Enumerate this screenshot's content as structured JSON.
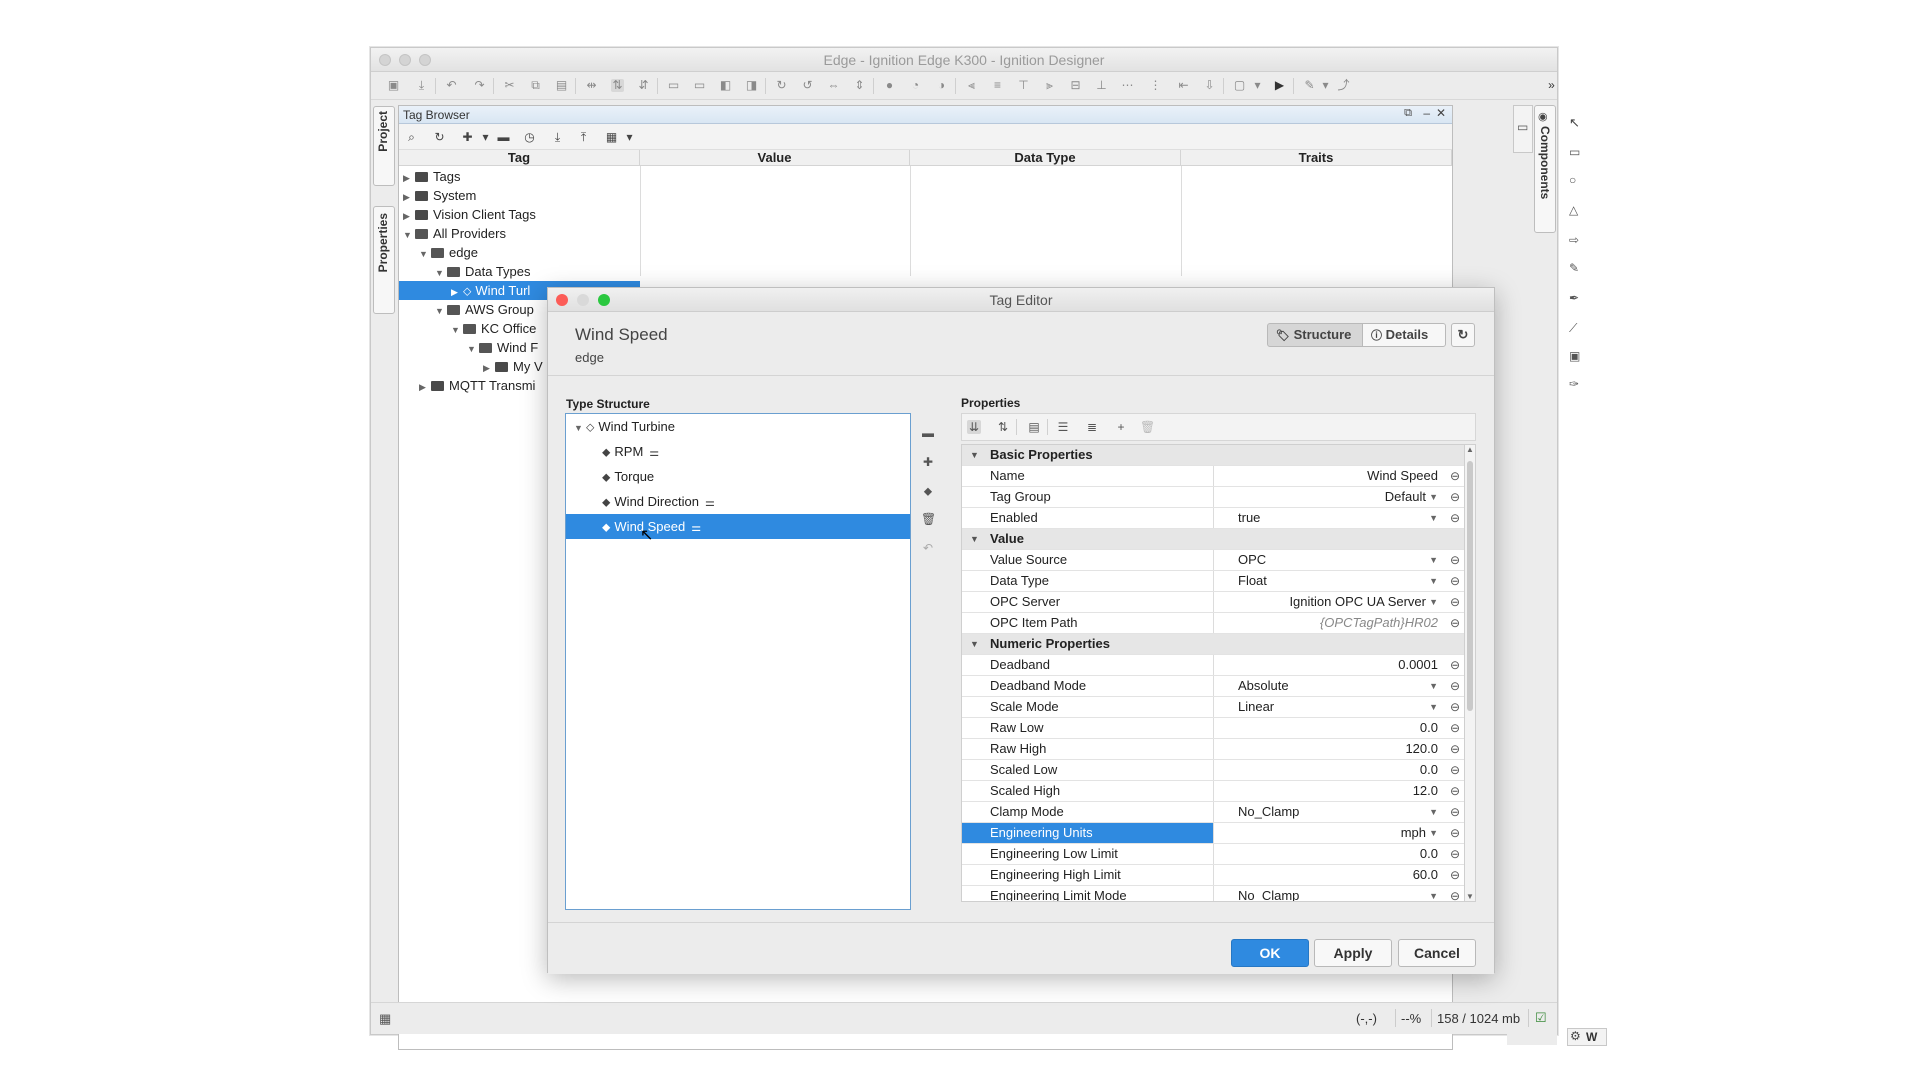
{
  "window": {
    "title": "Edge - Ignition Edge K300 - Ignition Designer"
  },
  "left_tabs": {
    "project": "Project",
    "properties": "Properties"
  },
  "right_tabs": {
    "components": "Components",
    "w_label": "W"
  },
  "tag_browser": {
    "title": "Tag Browser",
    "columns": [
      "Tag",
      "Value",
      "Data Type",
      "Traits"
    ],
    "tree": [
      {
        "label": "Tags",
        "depth": 0,
        "expanded": false,
        "kind": "folder"
      },
      {
        "label": "System",
        "depth": 0,
        "expanded": false,
        "kind": "folder"
      },
      {
        "label": "Vision Client Tags",
        "depth": 0,
        "expanded": false,
        "kind": "folder"
      },
      {
        "label": "All Providers",
        "depth": 0,
        "expanded": true,
        "kind": "folder"
      },
      {
        "label": "edge",
        "depth": 1,
        "expanded": true,
        "kind": "folder"
      },
      {
        "label": "Data Types",
        "depth": 2,
        "expanded": true,
        "kind": "folder"
      },
      {
        "label": "Wind Turl",
        "depth": 3,
        "expanded": false,
        "kind": "udt",
        "selected": true
      },
      {
        "label": "AWS Group",
        "depth": 2,
        "expanded": true,
        "kind": "folder"
      },
      {
        "label": "KC Office",
        "depth": 3,
        "expanded": true,
        "kind": "folder"
      },
      {
        "label": "Wind F",
        "depth": 4,
        "expanded": true,
        "kind": "folder"
      },
      {
        "label": "My V",
        "depth": 5,
        "expanded": false,
        "kind": "folder"
      },
      {
        "label": "MQTT Transmi",
        "depth": 1,
        "expanded": false,
        "kind": "folder"
      }
    ]
  },
  "status_bar": {
    "coords": "(-,-)",
    "zoom": "--%",
    "memory": "158 / 1024 mb"
  },
  "tag_editor": {
    "title": "Tag Editor",
    "tag_name": "Wind Speed",
    "provider": "edge",
    "structure_btn": "Structure",
    "details_btn": "Details",
    "type_structure_label": "Type Structure",
    "type_structure": [
      {
        "label": "Wind Turbine",
        "depth": 0,
        "expanded": true,
        "params": false,
        "selected": false
      },
      {
        "label": "RPM",
        "depth": 1,
        "params": true,
        "selected": false
      },
      {
        "label": "Torque",
        "depth": 1,
        "params": false,
        "selected": false
      },
      {
        "label": "Wind Direction",
        "depth": 1,
        "params": true,
        "selected": false
      },
      {
        "label": "Wind Speed",
        "depth": 1,
        "params": true,
        "selected": true
      }
    ],
    "properties_label": "Properties",
    "properties": [
      {
        "type": "cat",
        "name": "Basic Properties"
      },
      {
        "name": "Name",
        "value": "Wind Speed",
        "align": "right",
        "dropdown": false
      },
      {
        "name": "Tag Group",
        "value": "Default",
        "align": "right",
        "dropdown": true
      },
      {
        "name": "Enabled",
        "value": "true",
        "align": "left",
        "dropdown": true
      },
      {
        "type": "cat",
        "name": "Value"
      },
      {
        "name": "Value Source",
        "value": "OPC",
        "align": "left",
        "dropdown": true
      },
      {
        "name": "Data Type",
        "value": "Float",
        "align": "left",
        "dropdown": true
      },
      {
        "name": "OPC Server",
        "value": "Ignition OPC UA Server",
        "align": "right",
        "dropdown": true
      },
      {
        "name": "OPC Item Path",
        "value": "{OPCTagPath}HR02",
        "align": "right",
        "dropdown": false,
        "italic": true
      },
      {
        "type": "cat",
        "name": "Numeric Properties"
      },
      {
        "name": "Deadband",
        "value": "0.0001",
        "align": "right",
        "dropdown": false
      },
      {
        "name": "Deadband Mode",
        "value": "Absolute",
        "align": "left",
        "dropdown": true
      },
      {
        "name": "Scale Mode",
        "value": "Linear",
        "align": "left",
        "dropdown": true
      },
      {
        "name": "Raw Low",
        "value": "0.0",
        "align": "right",
        "dropdown": false
      },
      {
        "name": "Raw High",
        "value": "120.0",
        "align": "right",
        "dropdown": false
      },
      {
        "name": "Scaled Low",
        "value": "0.0",
        "align": "right",
        "dropdown": false
      },
      {
        "name": "Scaled High",
        "value": "12.0",
        "align": "right",
        "dropdown": false
      },
      {
        "name": "Clamp Mode",
        "value": "No_Clamp",
        "align": "left",
        "dropdown": true
      },
      {
        "name": "Engineering Units",
        "value": "mph",
        "align": "right",
        "dropdown": true,
        "selected": true
      },
      {
        "name": "Engineering Low Limit",
        "value": "0.0",
        "align": "right",
        "dropdown": false
      },
      {
        "name": "Engineering High Limit",
        "value": "60.0",
        "align": "right",
        "dropdown": false
      },
      {
        "name": "Engineering Limit Mode",
        "value": "No_Clamp",
        "align": "left",
        "dropdown": true
      }
    ],
    "ok": "OK",
    "apply": "Apply",
    "cancel": "Cancel"
  },
  "colors": {
    "selection": "#2f8ae0",
    "ok_button": "#2f8ae0",
    "close_dot": "#fc5c57",
    "min_dot": "#d9d9d9",
    "max_dot": "#2bc840"
  }
}
